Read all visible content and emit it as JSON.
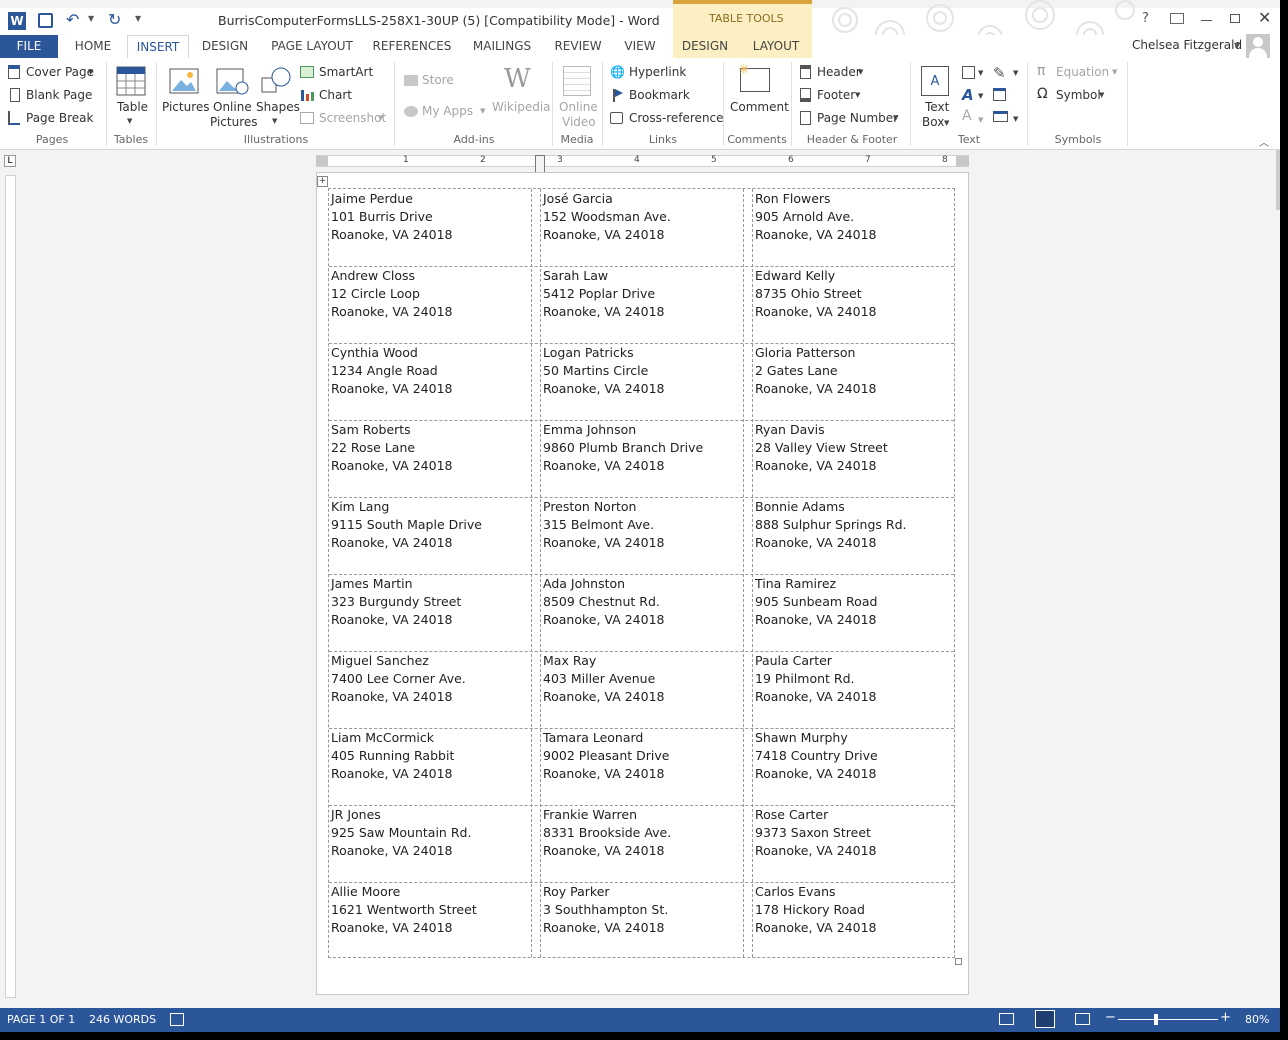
{
  "title": "BurrisComputerFormsLLS-258X1-30UP (5) [Compatibility Mode] - Word",
  "table_tools": "TABLE TOOLS",
  "user": "Chelsea Fitzgerald",
  "tabs": [
    "FILE",
    "HOME",
    "INSERT",
    "DESIGN",
    "PAGE LAYOUT",
    "REFERENCES",
    "MAILINGS",
    "REVIEW",
    "VIEW",
    "DESIGN",
    "LAYOUT"
  ],
  "ribbon": {
    "pages": {
      "cover": "Cover Page",
      "blank": "Blank Page",
      "break": "Page Break",
      "label": "Pages"
    },
    "tables": {
      "table": "Table",
      "label": "Tables"
    },
    "illus": {
      "pictures": "Pictures",
      "online1": "Online",
      "online2": "Pictures",
      "shapes": "Shapes",
      "smartart": "SmartArt",
      "chart": "Chart",
      "screenshot": "Screenshot",
      "label": "Illustrations"
    },
    "addins": {
      "store": "Store",
      "myapps": "My Apps",
      "wiki": "Wikipedia",
      "label": "Add-ins"
    },
    "media": {
      "ov1": "Online",
      "ov2": "Video",
      "label": "Media"
    },
    "links": {
      "hyperlink": "Hyperlink",
      "bookmark": "Bookmark",
      "cross": "Cross-reference",
      "label": "Links"
    },
    "comments": {
      "comment": "Comment",
      "label": "Comments"
    },
    "hf": {
      "header": "Header",
      "footer": "Footer",
      "pagenum": "Page Number",
      "label": "Header & Footer"
    },
    "text": {
      "tb1": "Text",
      "tb2": "Box",
      "label": "Text"
    },
    "symbols": {
      "equation": "Equation",
      "symbol": "Symbol",
      "label": "Symbols"
    }
  },
  "ruler": [
    "1",
    "2",
    "3",
    "4",
    "5",
    "6",
    "7",
    "8"
  ],
  "labels": [
    [
      "Jaime Perdue",
      "101 Burris Drive",
      "Roanoke, VA 24018"
    ],
    [
      "José Garcia",
      "152 Woodsman Ave.",
      "Roanoke, VA 24018"
    ],
    [
      "Ron Flowers",
      "905 Arnold Ave.",
      "Roanoke, VA 24018"
    ],
    [
      "Andrew Closs",
      "12 Circle Loop",
      "Roanoke, VA 24018"
    ],
    [
      "Sarah Law",
      "5412 Poplar Drive",
      "Roanoke, VA 24018"
    ],
    [
      "Edward Kelly",
      "8735 Ohio Street",
      "Roanoke, VA 24018"
    ],
    [
      "Cynthia Wood",
      "1234 Angle Road",
      "Roanoke, VA 24018"
    ],
    [
      "Logan Patricks",
      "50 Martins Circle",
      "Roanoke, VA 24018"
    ],
    [
      "Gloria Patterson",
      "2 Gates Lane",
      "Roanoke, VA 24018"
    ],
    [
      "Sam Roberts",
      "22 Rose Lane",
      "Roanoke, VA 24018"
    ],
    [
      "Emma Johnson",
      "9860 Plumb Branch Drive",
      "Roanoke, VA 24018"
    ],
    [
      "Ryan Davis",
      "28 Valley View Street",
      "Roanoke, VA 24018"
    ],
    [
      "Kim Lang",
      "9115 South Maple Drive",
      "Roanoke, VA 24018"
    ],
    [
      "Preston Norton",
      "315 Belmont Ave.",
      "Roanoke, VA 24018"
    ],
    [
      "Bonnie Adams",
      "888 Sulphur Springs Rd.",
      "Roanoke, VA 24018"
    ],
    [
      "James Martin",
      "323 Burgundy Street",
      "Roanoke, VA 24018"
    ],
    [
      "Ada Johnston",
      "8509 Chestnut Rd.",
      "Roanoke, VA 24018"
    ],
    [
      "Tina Ramirez",
      "905 Sunbeam Road",
      "Roanoke, VA 24018"
    ],
    [
      "Miguel Sanchez",
      "7400 Lee Corner Ave.",
      "Roanoke, VA 24018"
    ],
    [
      "Max Ray",
      "403 Miller Avenue",
      "Roanoke, VA 24018"
    ],
    [
      "Paula Carter",
      "19 Philmont Rd.",
      "Roanoke, VA 24018"
    ],
    [
      "Liam McCormick",
      "405 Running Rabbit",
      "Roanoke, VA 24018"
    ],
    [
      "Tamara Leonard",
      "9002 Pleasant Drive",
      "Roanoke, VA 24018"
    ],
    [
      "Shawn Murphy",
      "7418 Country Drive",
      "Roanoke, VA 24018"
    ],
    [
      "JR Jones",
      "925 Saw Mountain Rd.",
      "Roanoke, VA 24018"
    ],
    [
      "Frankie Warren",
      "8331 Brookside Ave.",
      "Roanoke, VA 24018"
    ],
    [
      "Rose Carter",
      "9373 Saxon Street",
      "Roanoke, VA 24018"
    ],
    [
      "Allie Moore",
      "1621 Wentworth Street",
      "Roanoke, VA 24018"
    ],
    [
      "Roy Parker",
      "3 Southhampton St.",
      "Roanoke, VA 24018"
    ],
    [
      "Carlos Evans",
      "178 Hickory Road",
      "Roanoke, VA 24018"
    ]
  ],
  "status": {
    "page": "PAGE 1 OF 1",
    "words": "246 WORDS",
    "zoom": "80%"
  },
  "colors": {
    "accent": "#2b579a",
    "tabletools": "#fcefc3"
  }
}
